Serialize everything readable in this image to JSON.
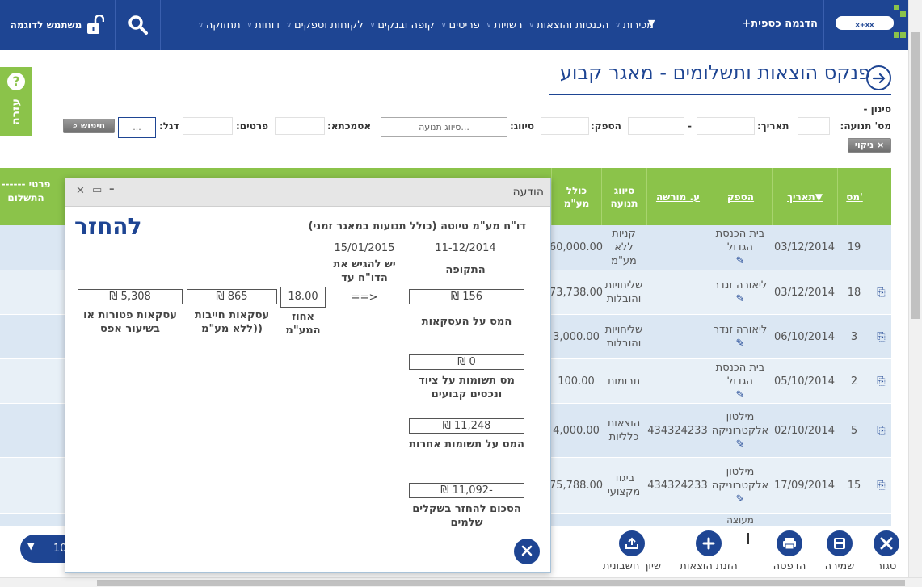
{
  "topbar": {
    "demo_link": "הדגמה כספית+",
    "nav": [
      "מכירות",
      "הכנסות והוצאות",
      "רשויות",
      "פריטים",
      "קופה ובנקים",
      "לקוחות וספקים",
      "דוחות",
      "תחזוקה"
    ],
    "user_label": "משתמש לדוגמה"
  },
  "help": {
    "label": "עזרה",
    "symbol": "?"
  },
  "page": {
    "title": "פנקס הוצאות ותשלומים - מאגר קבוע"
  },
  "filters": {
    "header": "סינון -",
    "doc_no_label": "מס' תנועה:",
    "date_label": "תאריך:",
    "date_sep": "-",
    "supplier_label": "הספק:",
    "classification_label": "סיווג:",
    "classification_placeholder": "סיווג תנועה...",
    "reference_label": "אסמכתא:",
    "details_label": "פרטים:",
    "flag_label": "דגל:",
    "flag_value": "...",
    "search_button": "חיפוש",
    "clear_button": "ניקוי"
  },
  "table": {
    "headers": {
      "no": "מס'",
      "date": "תאריך",
      "supplier": "הספק",
      "dealer": "ע. מורשה",
      "classification": "סיווג תנועה",
      "total_vat": "כולל מע\"מ",
      "payment_details": "------ פרטי התשלום"
    },
    "rows": [
      {
        "no": "19",
        "date": "03/12/2014",
        "supplier": "בית הכנסת הגדול",
        "dealer": "",
        "classification": "קניות ללא מע\"מ",
        "total": "60,000.00"
      },
      {
        "no": "18",
        "date": "03/12/2014",
        "supplier": "ליאורה זנדר",
        "dealer": "",
        "classification": "שליחויות והובלות",
        "total": "73,738.00"
      },
      {
        "no": "3",
        "date": "06/10/2014",
        "supplier": "ליאורה זנדר",
        "dealer": "",
        "classification": "שליחויות והובלות",
        "total": "3,000.00"
      },
      {
        "no": "2",
        "date": "05/10/2014",
        "supplier": "בית הכנסת הגדול",
        "dealer": "",
        "classification": "תרומות",
        "total": "100.00"
      },
      {
        "no": "5",
        "date": "02/10/2014",
        "supplier": "מילטון אלקטרוניקה",
        "dealer": "434324233",
        "classification": "הוצאות כלליות",
        "total": "4,000.00"
      },
      {
        "no": "15",
        "date": "17/09/2014",
        "supplier": "מילטון אלקטרוניקה",
        "dealer": "434324233",
        "classification": "ביגוד מקצועי",
        "total": "75,788.00"
      },
      {
        "no": "",
        "date": "",
        "supplier": "מעוצה",
        "dealer": "",
        "classification": "",
        "total": ""
      }
    ]
  },
  "dialog": {
    "title": "הודעה",
    "report_title": "דו\"ח מע\"מ טיוטה (כולל תנועות במאגר זמני)",
    "status_title": "להחזר",
    "period_value": "11-12/2014",
    "period_label": "התקופה",
    "due_date": "15/01/2015",
    "due_label": "יש להגיש את הדו\"ח עד",
    "arrow": "<==",
    "vat_rate_value": "18.00",
    "vat_rate_label": "אחוז המע\"מ",
    "taxable_value": "865 ₪",
    "taxable_label": "עסקאות חייבות ((ללא מע\"מ",
    "exempt_value": "5,308 ₪",
    "exempt_label": "עסקאות פטורות או בשיעור אפס",
    "tax_transactions_value": "156 ₪",
    "tax_transactions_label": "המס על העסקאות",
    "tax_fixed_assets_value": "0 ₪",
    "tax_fixed_assets_label": "מס תשומות על ציוד ונכסים קבועים",
    "tax_other_inputs_value": "11,248 ₪",
    "tax_other_inputs_label": "המס על תשומות אחרות",
    "refund_value": "-11,092 ₪",
    "refund_label": "הסכום להחזר בשקלים שלמים"
  },
  "toolbar": {
    "close": "סגור",
    "save": "שמירה",
    "print": "הדפסה",
    "enter_expenses": "הזנת הוצאות",
    "assign_account": "שיוך חשבונית",
    "pager_value": "10"
  },
  "colors": {
    "brand_blue": "#1e4593",
    "accent_green": "#8bc34a",
    "row_blue": "#dbe7f3"
  }
}
